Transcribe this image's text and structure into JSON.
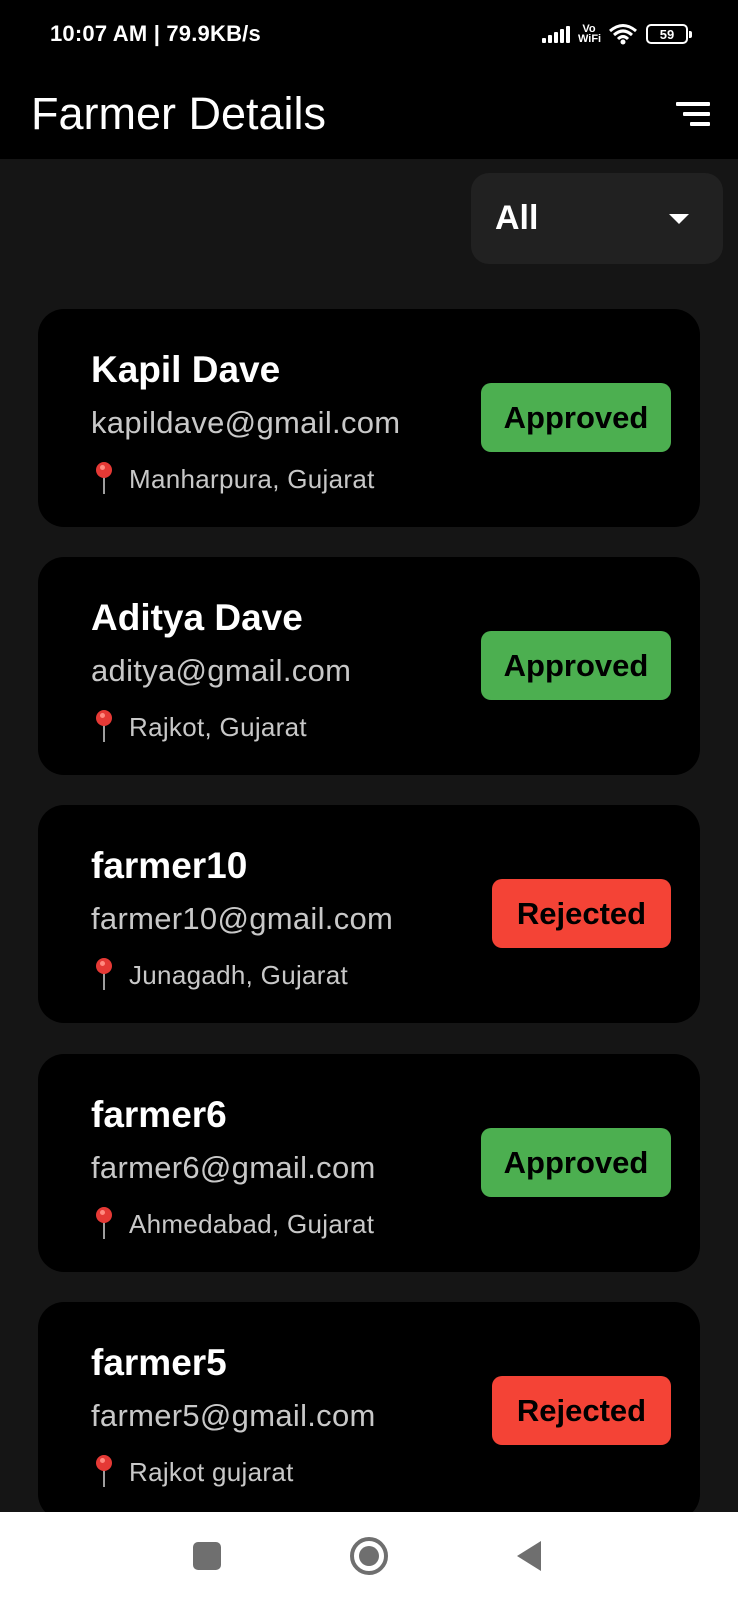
{
  "status_bar": {
    "time_speed": "10:07 AM | 79.9KB/s",
    "network_label": "Vo WiFi",
    "battery": "59",
    "icons": [
      "signal-icon",
      "vowifi-icon",
      "wifi-icon",
      "battery-icon"
    ]
  },
  "app_bar": {
    "title": "Farmer Details",
    "action_icon": "sort-icon"
  },
  "filter": {
    "selected": "All",
    "icon": "dropdown-arrow-icon"
  },
  "farmers": [
    {
      "name": "Kapil Dave",
      "email": "kapildave@gmail.com",
      "location": "Manharpura, Gujarat",
      "status": "Approved"
    },
    {
      "name": "Aditya Dave",
      "email": "aditya@gmail.com",
      "location": "Rajkot, Gujarat",
      "status": "Approved"
    },
    {
      "name": "farmer10",
      "email": "farmer10@gmail.com",
      "location": "Junagadh, Gujarat",
      "status": "Rejected"
    },
    {
      "name": "farmer6",
      "email": "farmer6@gmail.com",
      "location": "Ahmedabad, Gujarat",
      "status": "Approved"
    },
    {
      "name": "farmer5",
      "email": "farmer5@gmail.com",
      "location": "Rajkot gujarat",
      "status": "Rejected"
    }
  ],
  "colors": {
    "approved": "#4caf50",
    "rejected": "#f44336",
    "background": "#151515",
    "card": "#000000"
  },
  "nav_bar": {
    "icons": [
      "recents-icon",
      "home-icon",
      "back-icon"
    ]
  }
}
